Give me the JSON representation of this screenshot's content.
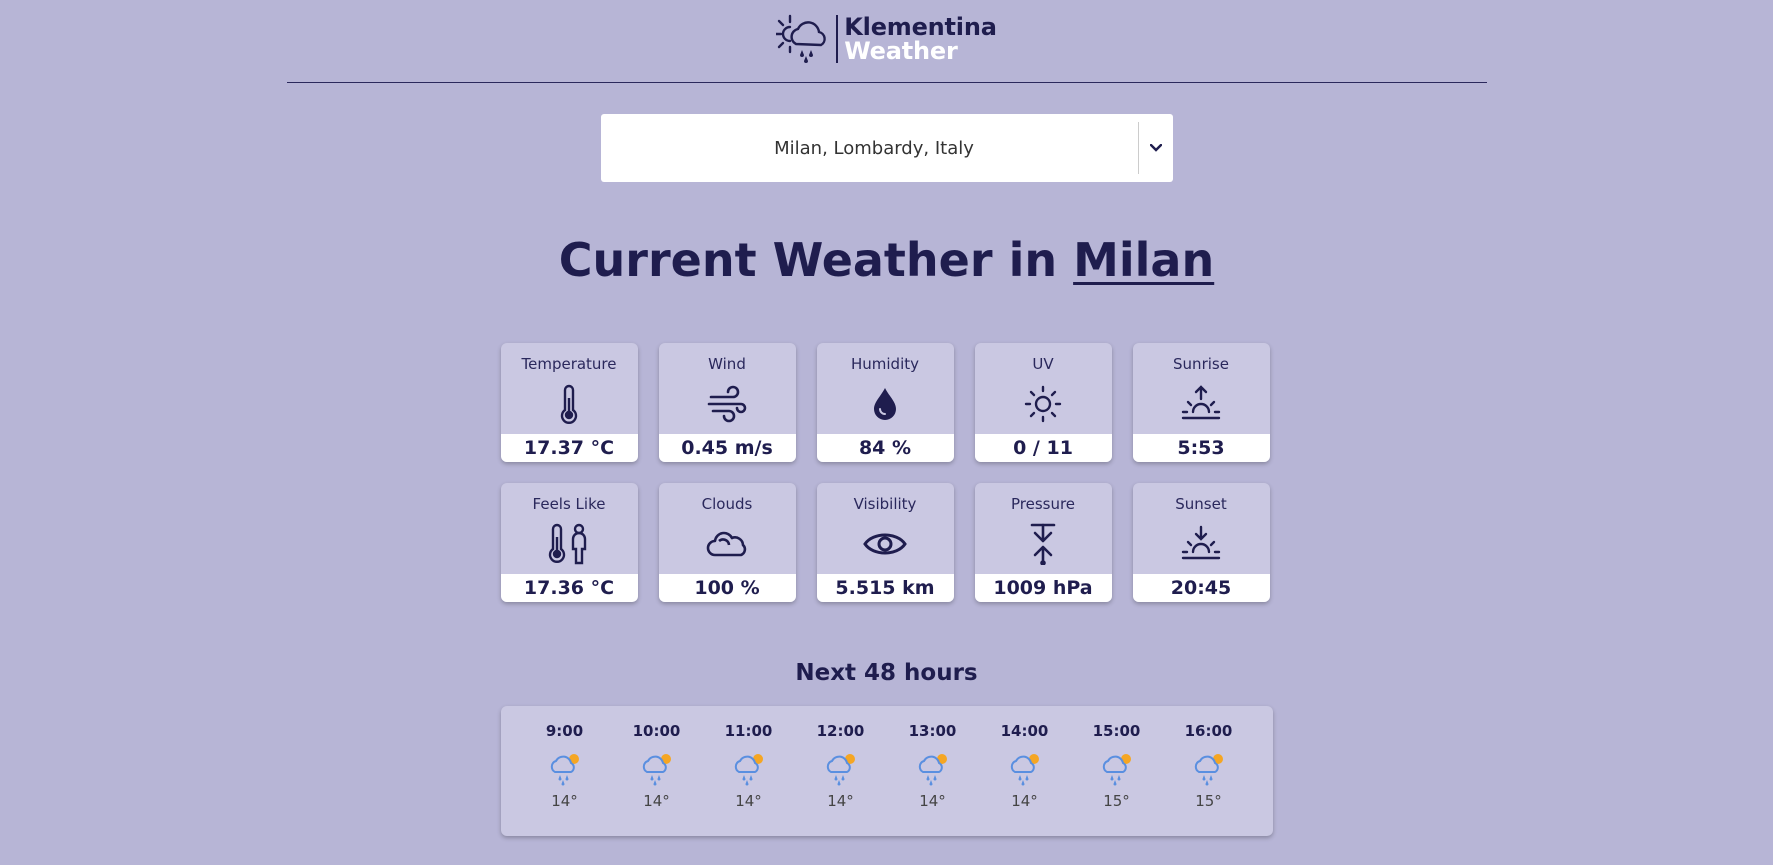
{
  "header": {
    "logo_line1": "Klementina",
    "logo_line2": "Weather"
  },
  "location": {
    "value": "Milan, Lombardy, Italy"
  },
  "title": {
    "prefix": "Current Weather in ",
    "city": "Milan"
  },
  "metrics": [
    {
      "label": "Temperature",
      "value": "17.37 °C",
      "icon": "thermometer-icon"
    },
    {
      "label": "Wind",
      "value": "0.45 m/s",
      "icon": "wind-icon"
    },
    {
      "label": "Humidity",
      "value": "84 %",
      "icon": "droplet-icon"
    },
    {
      "label": "UV",
      "value": "0 / 11",
      "icon": "sun-icon"
    },
    {
      "label": "Sunrise",
      "value": "5:53",
      "icon": "sunrise-icon"
    },
    {
      "label": "Feels Like",
      "value": "17.36 °C",
      "icon": "feels-like-icon"
    },
    {
      "label": "Clouds",
      "value": "100 %",
      "icon": "cloud-icon"
    },
    {
      "label": "Visibility",
      "value": "5.515 km",
      "icon": "eye-icon"
    },
    {
      "label": "Pressure",
      "value": "1009 hPa",
      "icon": "pressure-icon"
    },
    {
      "label": "Sunset",
      "value": "20:45",
      "icon": "sunset-icon"
    }
  ],
  "forecast": {
    "title": "Next 48 hours",
    "hours": [
      {
        "time": "9:00",
        "temp": "14°",
        "icon": "rain-sun-icon"
      },
      {
        "time": "10:00",
        "temp": "14°",
        "icon": "rain-sun-icon"
      },
      {
        "time": "11:00",
        "temp": "14°",
        "icon": "rain-sun-icon"
      },
      {
        "time": "12:00",
        "temp": "14°",
        "icon": "rain-sun-icon"
      },
      {
        "time": "13:00",
        "temp": "14°",
        "icon": "rain-sun-icon"
      },
      {
        "time": "14:00",
        "temp": "14°",
        "icon": "rain-sun-icon"
      },
      {
        "time": "15:00",
        "temp": "15°",
        "icon": "rain-sun-icon"
      },
      {
        "time": "16:00",
        "temp": "15°",
        "icon": "rain-sun-icon"
      }
    ]
  },
  "colors": {
    "background": "#b7b5d6",
    "card": "#cac8e2",
    "text": "#1f1d4e",
    "rain": "#5a8fe0",
    "sun": "#f5a623"
  }
}
